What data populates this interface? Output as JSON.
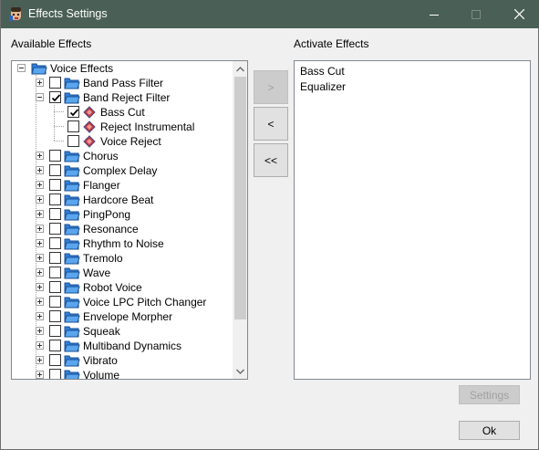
{
  "window": {
    "title": "Effects Settings"
  },
  "labels": {
    "available": "Available Effects",
    "active": "Activate Effects"
  },
  "tree": {
    "root": "Voice Effects",
    "groups": [
      "Band Pass Filter",
      "Band Reject Filter",
      "Chorus",
      "Complex Delay",
      "Flanger",
      "Hardcore Beat",
      "PingPong",
      "Resonance",
      "Rhythm to Noise",
      "Tremolo",
      "Wave",
      "Robot Voice",
      "Voice LPC Pitch Changer",
      "Envelope Morpher",
      "Squeak",
      "Multiband Dynamics",
      "Vibrato",
      "Volume"
    ],
    "children": [
      "Bass Cut",
      "Reject Instrumental",
      "Voice Reject"
    ]
  },
  "move_buttons": {
    "add": ">",
    "remove": "<",
    "remove_all": "<<"
  },
  "active_effects": [
    "Bass Cut",
    "Equalizer"
  ],
  "buttons": {
    "settings": "Settings",
    "ok": "Ok"
  }
}
